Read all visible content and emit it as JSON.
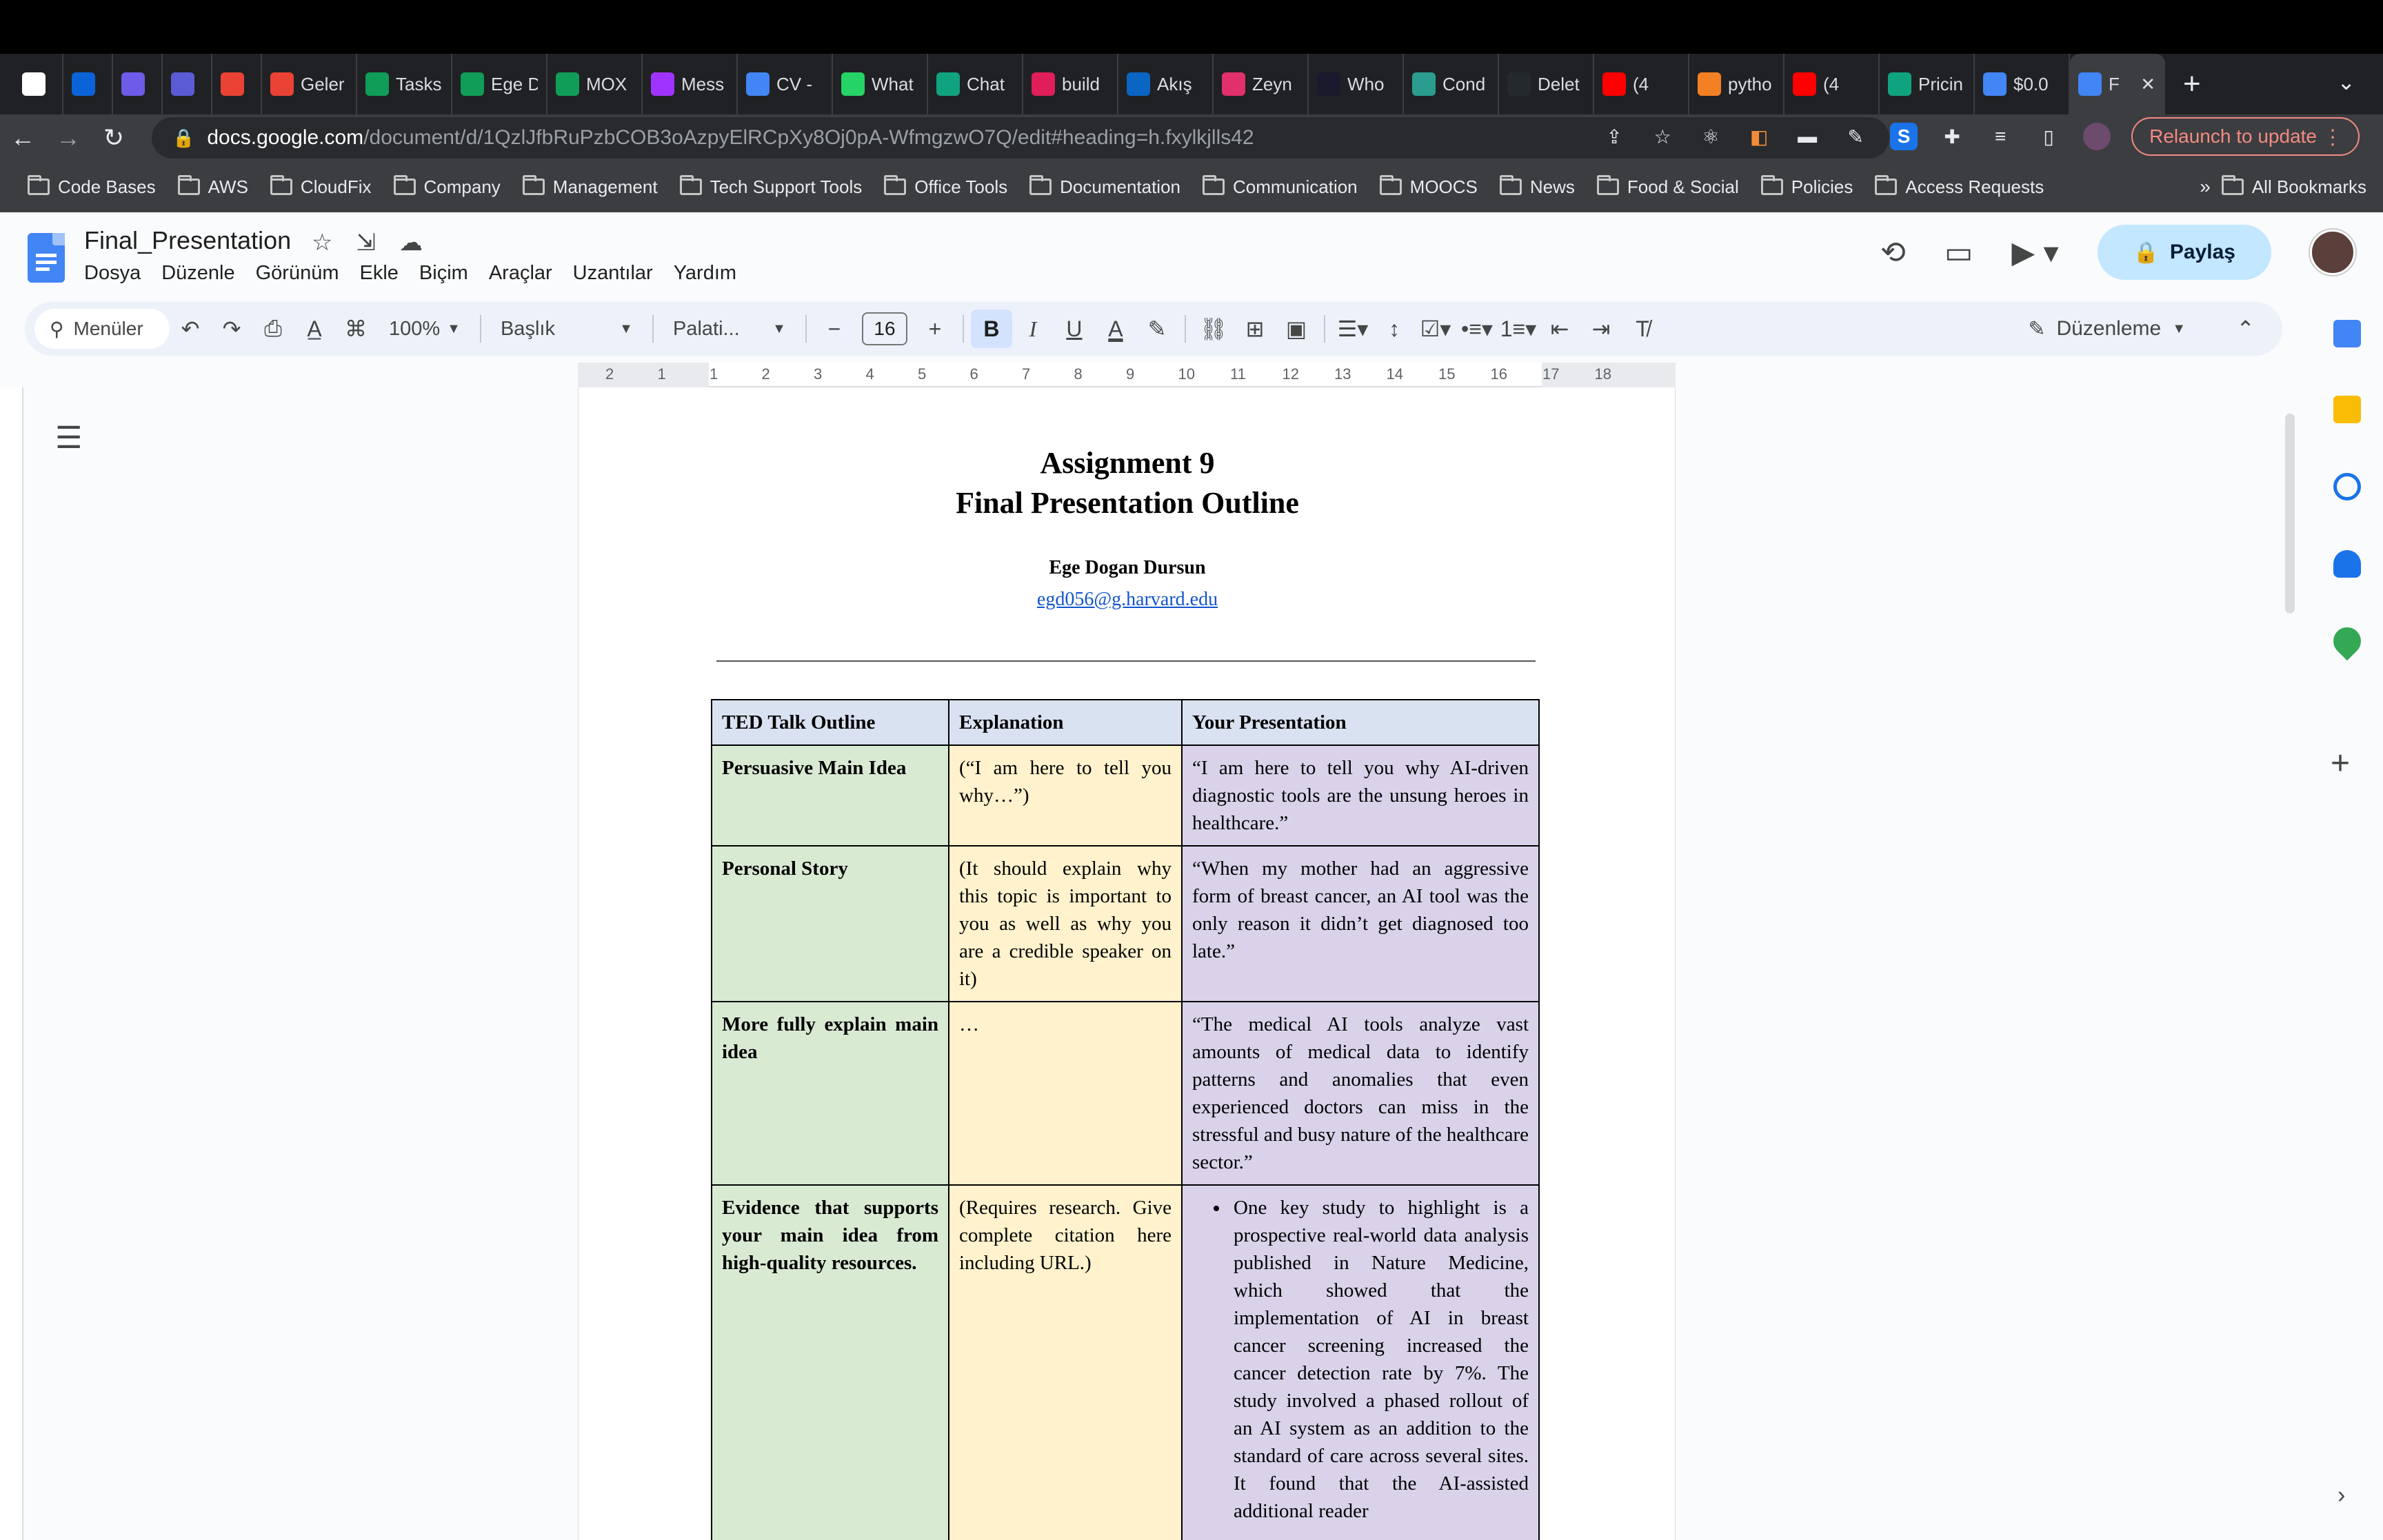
{
  "browser": {
    "tabs": [
      {
        "title": "",
        "icon": "apps-grid-icon",
        "color": "#ffffff"
      },
      {
        "title": "",
        "icon": "outlook-icon",
        "color": "#0a64d8"
      },
      {
        "title": "",
        "icon": "app-icon",
        "color": "#6c5ce7"
      },
      {
        "title": "",
        "icon": "app-icon",
        "color": "#5b5bd6"
      },
      {
        "title": "",
        "icon": "gmail-icon",
        "color": "#ea4335"
      },
      {
        "title": "Geler",
        "icon": "gmail-icon",
        "color": "#ea4335"
      },
      {
        "title": "Tasks",
        "icon": "tasks-icon",
        "color": "#0f9d58"
      },
      {
        "title": "Ege D",
        "icon": "sheets-icon",
        "color": "#0f9d58"
      },
      {
        "title": "MOX",
        "icon": "sheets-icon",
        "color": "#0f9d58"
      },
      {
        "title": "Mess",
        "icon": "messenger-icon",
        "color": "#a033ff"
      },
      {
        "title": "CV -",
        "icon": "docs-icon",
        "color": "#4285f4"
      },
      {
        "title": "What",
        "icon": "whatsapp-icon",
        "color": "#25d366"
      },
      {
        "title": "Chat",
        "icon": "chatgpt-icon",
        "color": "#10a37f"
      },
      {
        "title": "build",
        "icon": "slack-icon",
        "color": "#e01e5a"
      },
      {
        "title": "Akış",
        "icon": "linkedin-icon",
        "color": "#0a66c2"
      },
      {
        "title": "Zeyn",
        "icon": "instagram-icon",
        "color": "#e1306c"
      },
      {
        "title": "Who",
        "icon": "app-icon",
        "color": "#1a1a2e"
      },
      {
        "title": "Cond",
        "icon": "app-icon",
        "color": "#2a9d8f"
      },
      {
        "title": "Delet",
        "icon": "github-icon",
        "color": "#24292e"
      },
      {
        "title": "(4",
        "icon": "youtube-icon",
        "color": "#ff0000"
      },
      {
        "title": "pytho",
        "icon": "app-icon",
        "color": "#f48024"
      },
      {
        "title": "(4",
        "icon": "youtube-icon",
        "color": "#ff0000"
      },
      {
        "title": "Pricin",
        "icon": "chatgpt-icon",
        "color": "#10a37f"
      },
      {
        "title": "$0.0",
        "icon": "google-icon",
        "color": "#4285f4"
      },
      {
        "title": "F",
        "icon": "docs-icon",
        "color": "#4285f4"
      }
    ],
    "url_host": "docs.google.com",
    "url_path": "/document/d/1QzlJfbRuPzbCOB3oAzpyElRCpXy8Oj0pA-WfmgzwO7Q/edit#heading=h.fxylkjlls42",
    "relaunch_label": "Relaunch to update",
    "bookmarks": [
      "Code Bases",
      "AWS",
      "CloudFix",
      "Company",
      "Management",
      "Tech Support Tools",
      "Office Tools",
      "Documentation",
      "Communication",
      "MOOCS",
      "News",
      "Food & Social",
      "Policies",
      "Access Requests"
    ],
    "bookmarks_more": "»",
    "all_bookmarks": "All Bookmarks"
  },
  "docs": {
    "title": "Final_Presentation",
    "menu": [
      "Dosya",
      "Düzenle",
      "Görünüm",
      "Ekle",
      "Biçim",
      "Araçlar",
      "Uzantılar",
      "Yardım"
    ],
    "share_label": "Paylaş",
    "toolbar": {
      "search_label": "Menüler",
      "zoom": "100%",
      "style": "Başlık",
      "font": "Palati...",
      "font_size": "16",
      "mode": "Düzenleme"
    },
    "ruler_labels": [
      "2",
      "1",
      "1",
      "2",
      "3",
      "4",
      "5",
      "6",
      "7",
      "8",
      "9",
      "10",
      "11",
      "12",
      "13",
      "14",
      "15",
      "16",
      "17",
      "18"
    ]
  },
  "document": {
    "heading_line1": "Assignment 9",
    "heading_line2": "Final Presentation Outline",
    "author": "Ege Dogan Dursun",
    "email": "egd056@g.harvard.edu",
    "table": {
      "headers": [
        "TED Talk Outline",
        "Explanation",
        "Your Presentation"
      ],
      "rows": [
        {
          "c1": "Persuasive Main Idea",
          "c2": "(“I am here to tell you why…”)",
          "c3": "“I am here to tell you why AI-driven diagnostic tools are the unsung heroes in healthcare.”"
        },
        {
          "c1": "Personal Story",
          "c2": "(It should explain why this topic is important to you as well as why you are a credible speaker on it)",
          "c3": "“When my mother had an aggressive form of breast cancer, an AI tool was the only reason it didn’t get diagnosed too late.”"
        },
        {
          "c1": "More fully explain main idea",
          "c2": "…",
          "c3": "“The medical AI tools analyze vast amounts of medical data to identify patterns and anomalies that even experienced doctors can miss in the stressful and busy nature of the healthcare sector.”"
        },
        {
          "c1": "Evidence that supports your main idea from high-quality resources.",
          "c2": "(Requires research. Give complete citation here including URL.)",
          "c3_bullet": "One key study to highlight is a prospective real-world data analysis published in Nature Medicine, which showed that the implementation of AI in breast cancer screening increased the cancer detection rate by 7%. The study involved a phased rollout of an AI system as an addition to the standard of care across several sites. It found that the AI-assisted additional reader"
        }
      ]
    }
  }
}
